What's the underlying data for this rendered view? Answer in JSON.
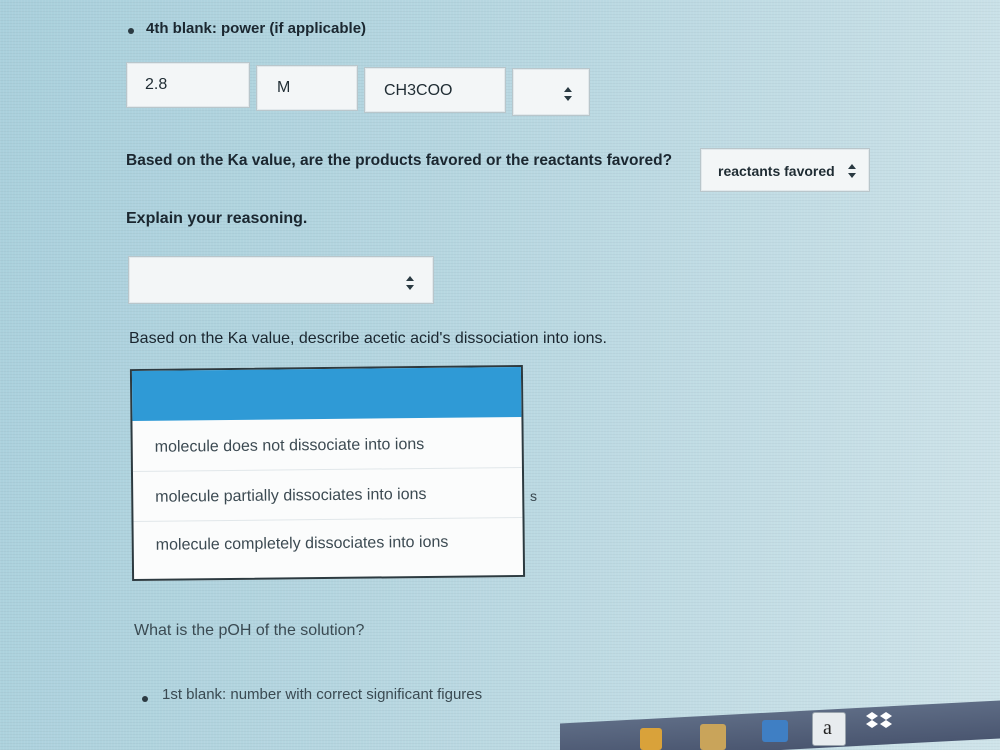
{
  "blank4": {
    "label": "4th blank: power (if applicable)"
  },
  "answer_row": {
    "value": "2.8",
    "unit": "M",
    "species": "CH3COO",
    "charge": ""
  },
  "q_favored": {
    "text": "Based on the Ka value, are the products favored or the reactants favored?",
    "selected": "reactants favored"
  },
  "q_reasoning": {
    "text": "Explain your reasoning.",
    "selected": ""
  },
  "q_dissociation": {
    "text": "Based on the Ka value, describe acetic acid's dissociation into ions.",
    "options": [
      "molecule does not dissociate into ions",
      "molecule partially dissociates into ions",
      "molecule completely dissociates into ions"
    ],
    "partial_hidden_text": "s"
  },
  "q_poh": {
    "text": "What is the pOH of the solution?"
  },
  "blank1": {
    "label": "1st blank: number with correct significant figures"
  },
  "taskbar": {
    "icons": [
      "lock-icon",
      "calendar-icon",
      "mail-icon",
      "amazon-icon",
      "dropbox-icon"
    ],
    "amazon_letter": "a"
  }
}
